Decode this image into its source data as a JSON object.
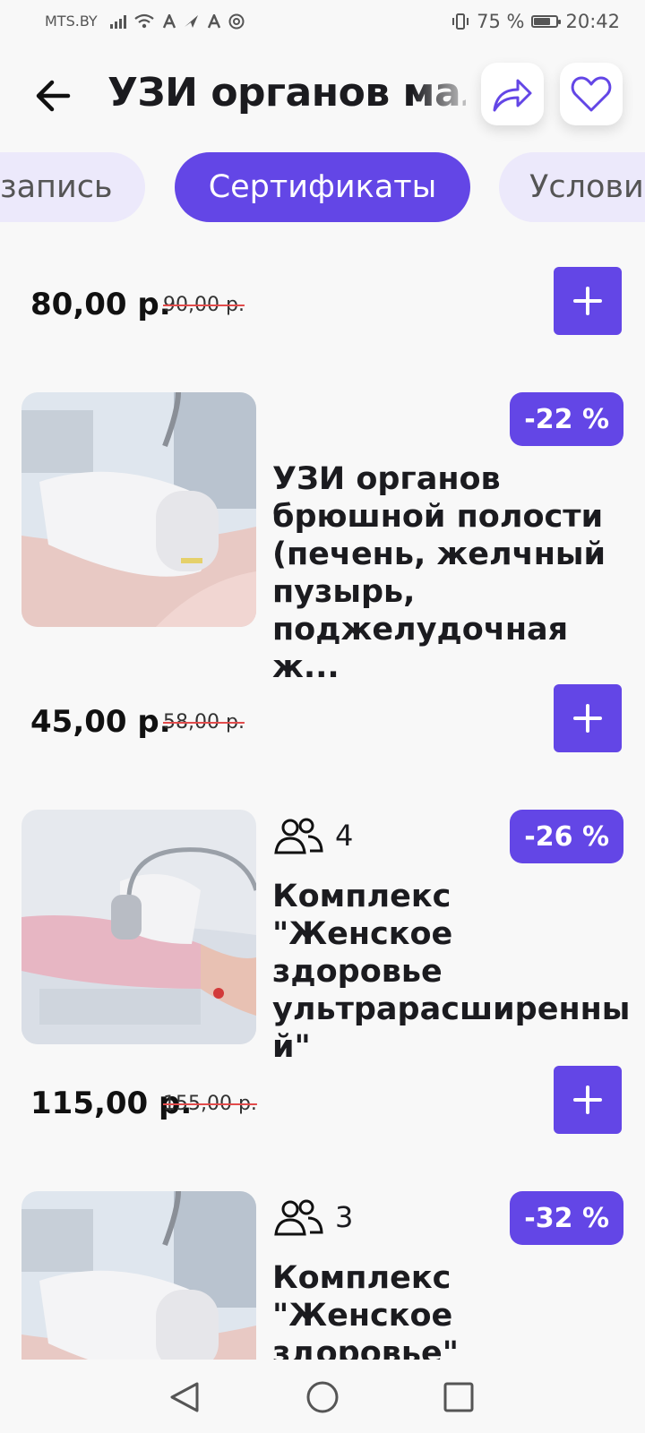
{
  "status_bar": {
    "carrier": "MTS.BY",
    "battery_text": "75 %",
    "battery_level": 0.75,
    "time": "20:42"
  },
  "header": {
    "title": "УЗИ органов малого таза",
    "back_icon": "arrow-left-icon",
    "share_icon": "share-icon",
    "favorite_icon": "heart-icon"
  },
  "tabs": [
    {
      "label": "запись",
      "active": false
    },
    {
      "label": "Сертификаты",
      "active": true
    },
    {
      "label": "Условия",
      "active": false
    }
  ],
  "colors": {
    "accent": "#6346e6",
    "accent_light": "#ece9fb",
    "strike": "#e24c4c"
  },
  "items": [
    {
      "price": "80,00 р.",
      "old_price": "90,00 р."
    },
    {
      "discount": "-22 %",
      "title": "УЗИ органов брюшной полости (печень, желчный пузырь, поджелудочная ж...",
      "price": "45,00 р.",
      "old_price": "58,00 р."
    },
    {
      "discount": "-26 %",
      "people_count": "4",
      "title": "Комплекс \"Женское здоровье ультрарасширенны й\"",
      "price": "115,00 р.",
      "old_price": "155,00 р."
    },
    {
      "discount": "-32 %",
      "people_count": "3",
      "title": "Комплекс \"Женское здоровье\""
    }
  ]
}
